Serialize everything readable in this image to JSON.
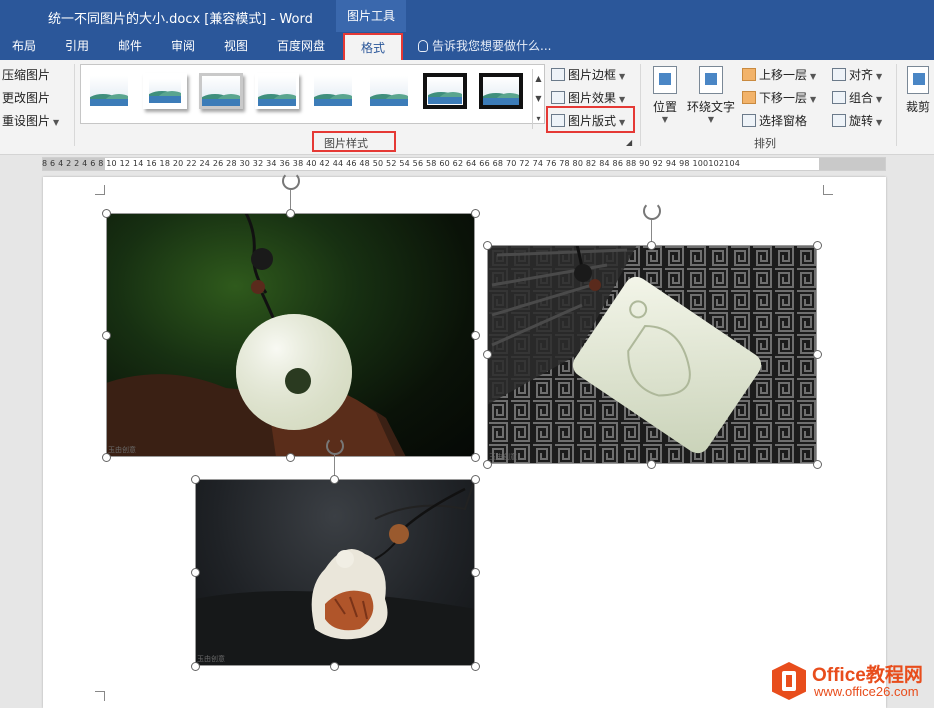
{
  "titlebar": {
    "doc_title": "统一不同图片的大小.docx [兼容模式] - Word",
    "context_tool": "图片工具"
  },
  "tabs": {
    "items": [
      "布局",
      "引用",
      "邮件",
      "审阅",
      "视图",
      "百度网盘"
    ],
    "active": "格式",
    "tell_me": "告诉我您想要做什么..."
  },
  "ribbon": {
    "adjust": {
      "compress": "压缩图片",
      "change": "更改图片",
      "reset": "重设图片"
    },
    "picture_styles": {
      "group_label": "图片样式",
      "border": "图片边框",
      "effects": "图片效果",
      "layout": "图片版式"
    },
    "arrange": {
      "position": "位置",
      "wrap_text": "环绕文字",
      "bring_forward": "上移一层",
      "send_backward": "下移一层",
      "selection_pane": "选择窗格",
      "align": "对齐",
      "group": "组合",
      "rotate": "旋转",
      "group_label": "排列"
    },
    "size": {
      "crop": "裁剪"
    }
  },
  "ruler": {
    "numbers": "8  6  4  2       2   4   6   8  10  12  14  16  18  20  22  24  26  28  30  32  34  36  38  40  42  44  46  48  50  52  54  56  58  60  62  64  66  68  70  72  74  76  78  80  82  84  86  88  90  92  94          98  100102104"
  },
  "watermarks": {
    "img1": "玉由创意",
    "img2": "玉由创意",
    "img3": "玉由创意"
  },
  "logo": {
    "name": "Office教程网",
    "url": "www.office26.com"
  },
  "colors": {
    "title_bar": "#2b579a",
    "highlight": "#e53935",
    "logo": "#e84d1c"
  }
}
